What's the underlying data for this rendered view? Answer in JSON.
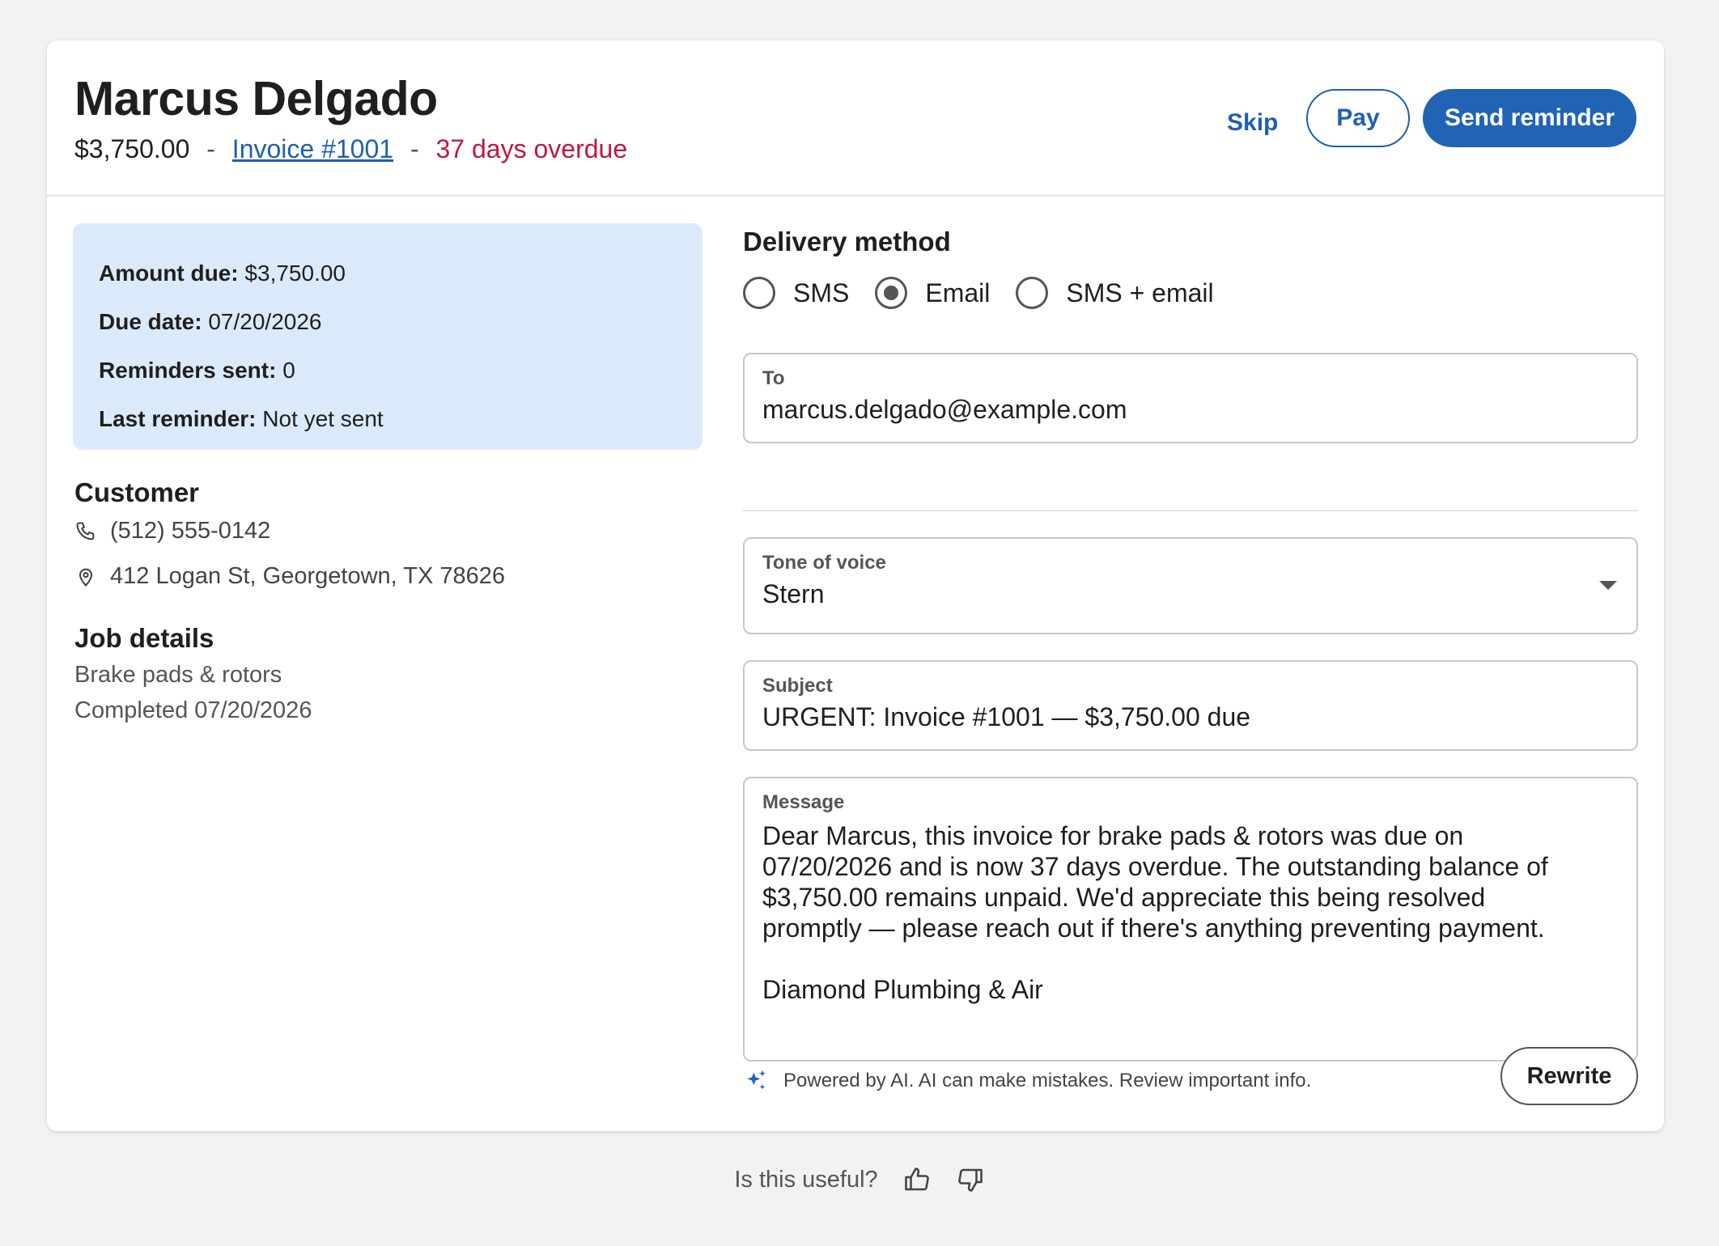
{
  "header": {
    "customer_name": "Marcus Delgado",
    "amount": "$3,750.00",
    "separator": "-",
    "invoice_label": "Invoice #1001",
    "overdue_text": "37 days overdue",
    "skip_label": "Skip",
    "pay_label": "Pay",
    "send_label": "Send reminder"
  },
  "summary": {
    "amount_due_label": "Amount due:",
    "amount_due_value": "$3,750.00",
    "due_date_label": "Due date:",
    "due_date_value": "07/20/2026",
    "reminders_label": "Reminders sent:",
    "reminders_value": "0",
    "last_reminder_label": "Last reminder:",
    "last_reminder_value": "Not yet sent"
  },
  "customer": {
    "title": "Customer",
    "phone": "(512) 555-0142",
    "address": "412 Logan St, Georgetown, TX 78626"
  },
  "job": {
    "title": "Job details",
    "description": "Brake pads & rotors",
    "completed": "Completed 07/20/2026"
  },
  "delivery": {
    "title": "Delivery method",
    "options": [
      {
        "label": "SMS",
        "checked": false
      },
      {
        "label": "Email",
        "checked": true
      },
      {
        "label": "SMS + email",
        "checked": false
      }
    ]
  },
  "form": {
    "to_label": "To",
    "to_value": "marcus.delgado@example.com",
    "tone_label": "Tone of voice",
    "tone_value": "Stern",
    "subject_label": "Subject",
    "subject_value": "URGENT: Invoice #1001 — $3,750.00 due",
    "message_label": "Message",
    "message_value": "Dear Marcus, this invoice for brake pads & rotors was due on\n07/20/2026 and is now 37 days overdue. The outstanding balance of\n$3,750.00 remains unpaid. We'd appreciate this being resolved\npromptly — please reach out if there's anything preventing payment.\n\nDiamond Plumbing & Air"
  },
  "ai": {
    "note": "Powered by AI. AI can make mistakes. Review important info.",
    "rewrite_label": "Rewrite"
  },
  "feedback": {
    "question": "Is this useful?"
  },
  "colors": {
    "primary": "#2163b5",
    "link": "#1f5fb3",
    "overdue": "#c4173a",
    "summary_bg": "#dbeafa"
  }
}
